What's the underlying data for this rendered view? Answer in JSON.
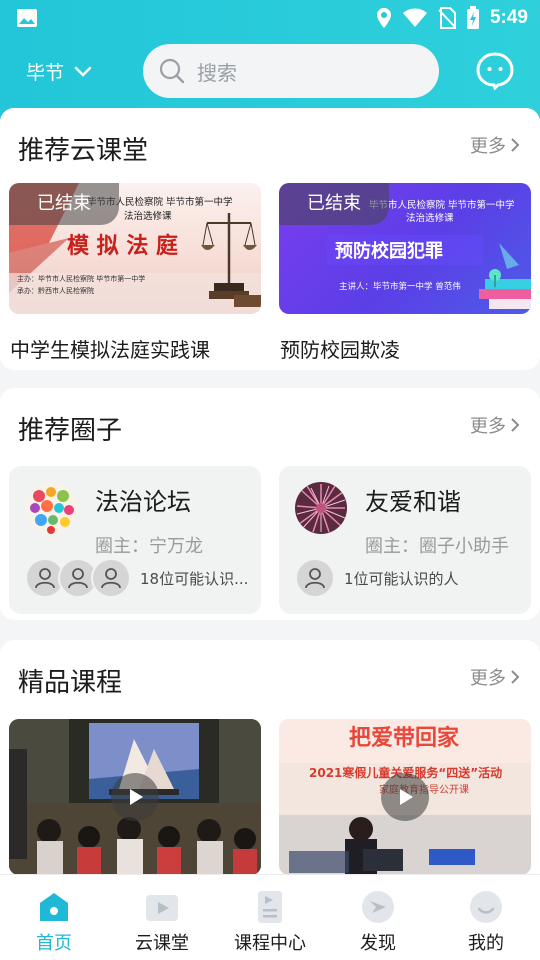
{
  "status_bar": {
    "time": "5:49"
  },
  "header": {
    "city": "毕节",
    "search_placeholder": "搜索"
  },
  "sections": {
    "cloud": {
      "title": "推荐云课堂",
      "more": "更多",
      "items": [
        {
          "badge": "已结束",
          "caption": "中学生模拟法庭实践课",
          "poster_line1": "毕节市人民检察院  毕节市第一中学",
          "poster_line2": "法治选修课",
          "poster_title": "模拟法庭",
          "poster_host1": "主办：毕节市人民检察院  毕节市第一中学",
          "poster_host2": "承办：黔西市人民检察院"
        },
        {
          "badge": "已结束",
          "caption": "预防校园欺凌",
          "poster_line1": "毕节市人民检察院  毕节市第一中学",
          "poster_line2": "法治选修课",
          "poster_title": "预防校园犯罪",
          "poster_host": "主讲人：毕节市第一中学  曾范伟"
        }
      ]
    },
    "circles": {
      "title": "推荐圈子",
      "more": "更多",
      "items": [
        {
          "name": "法治论坛",
          "owner": "圈主：宁万龙",
          "people": "18位可能认识..."
        },
        {
          "name": "友爱和谐",
          "owner": "圈主：圈子小助手",
          "people": "1位可能认识的人"
        }
      ]
    },
    "courses": {
      "title": "精品课程",
      "more": "更多",
      "items": [
        {
          "label": ""
        },
        {
          "banner": "把爱带回家",
          "subtitle": "2021寒假儿童关爱服务“四送”活动",
          "subtitle2": "家庭教育指导公开课"
        }
      ]
    }
  },
  "bottom_nav": [
    {
      "label": "首页",
      "active": true
    },
    {
      "label": "云课堂",
      "active": false
    },
    {
      "label": "课程中心",
      "active": false
    },
    {
      "label": "发现",
      "active": false
    },
    {
      "label": "我的",
      "active": false
    }
  ],
  "colors": {
    "accent": "#1fb8d6",
    "header": "#22c6d8"
  }
}
